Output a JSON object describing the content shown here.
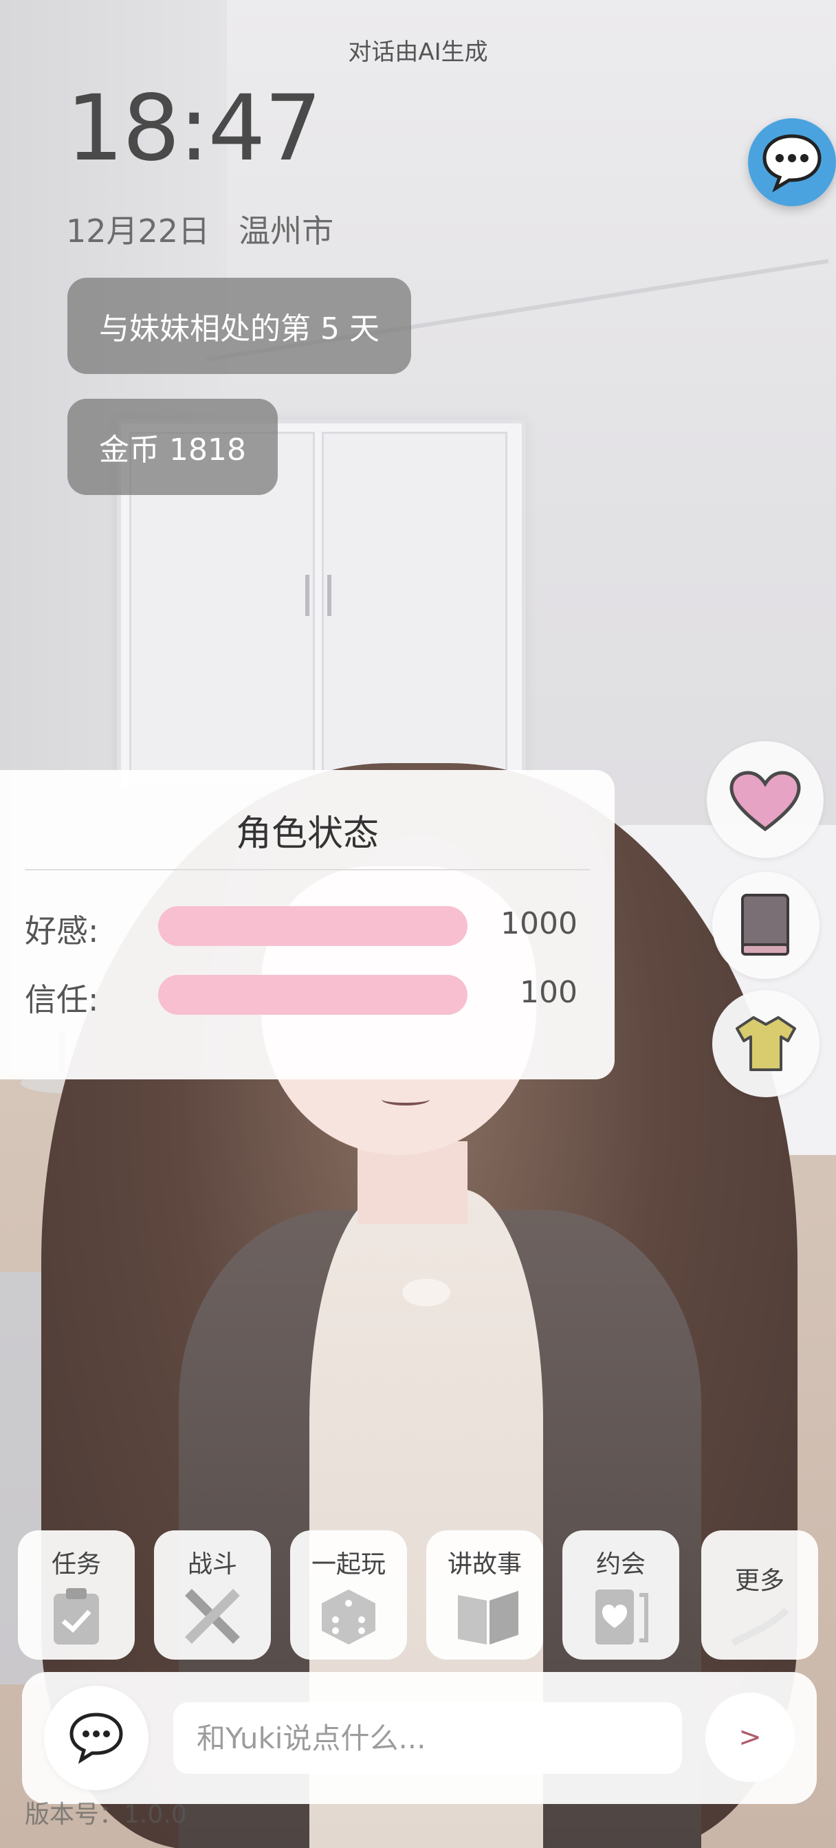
{
  "header": {
    "ai_note": "对话由AI生成"
  },
  "status": {
    "time": "18:47",
    "date": "12月22日",
    "city": "温州市"
  },
  "pills": {
    "days": "与妹妹相处的第 5 天",
    "coins": "金币 1818"
  },
  "character_status": {
    "title": "角色状态",
    "stats": [
      {
        "label": "好感:",
        "value": "1000",
        "fill": 1.0
      },
      {
        "label": "信任:",
        "value": "100",
        "fill": 1.0
      }
    ]
  },
  "side_buttons": [
    {
      "icon": "heart-icon",
      "color": "#e6a3c4"
    },
    {
      "icon": "book-icon",
      "color": "#7a6f74"
    },
    {
      "icon": "shirt-icon",
      "color": "#d8cc6e"
    }
  ],
  "actions": [
    {
      "label": "任务",
      "icon": "clipboard-check-icon"
    },
    {
      "label": "战斗",
      "icon": "crossed-swords-icon"
    },
    {
      "label": "一起玩",
      "icon": "dice-icon"
    },
    {
      "label": "讲故事",
      "icon": "open-book-icon"
    },
    {
      "label": "约会",
      "icon": "heart-card-icon"
    },
    {
      "label": "更多",
      "icon": "more-icon"
    }
  ],
  "input": {
    "placeholder": "和Yuki说点什么...",
    "send_label": ">"
  },
  "footer": {
    "version": "版本号：1.0.0"
  },
  "colors": {
    "accent_blue": "#4aa3df",
    "bar_pink": "#f7bfd0",
    "send_arrow": "#b05b6d"
  }
}
